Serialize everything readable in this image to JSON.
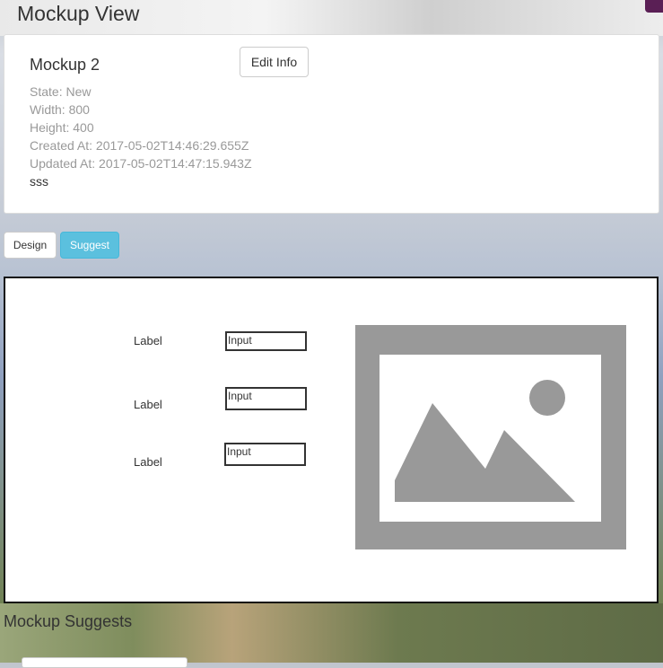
{
  "header": {
    "title": "Mockup View"
  },
  "info": {
    "name": "Mockup 2",
    "edit_label": "Edit Info",
    "state": "State: New",
    "width": "Width: 800",
    "height": "Height: 400",
    "created": "Created At: 2017-05-02T14:46:29.655Z",
    "updated": "Updated At: 2017-05-02T14:47:15.943Z",
    "description": "sss"
  },
  "tabs": {
    "design": "Design",
    "suggest": "Suggest",
    "active": "Suggest"
  },
  "canvas": {
    "rows": [
      {
        "label": "Label",
        "input": "Input"
      },
      {
        "label": "Label",
        "input": "Input"
      },
      {
        "label": "Label",
        "input": "Input"
      }
    ],
    "image_icon": "image-placeholder-icon"
  },
  "suggests": {
    "title": "Mockup Suggests"
  },
  "colors": {
    "accent": "#5bc0de",
    "badge": "#5a1f55",
    "placeholder_gray": "#999999"
  }
}
